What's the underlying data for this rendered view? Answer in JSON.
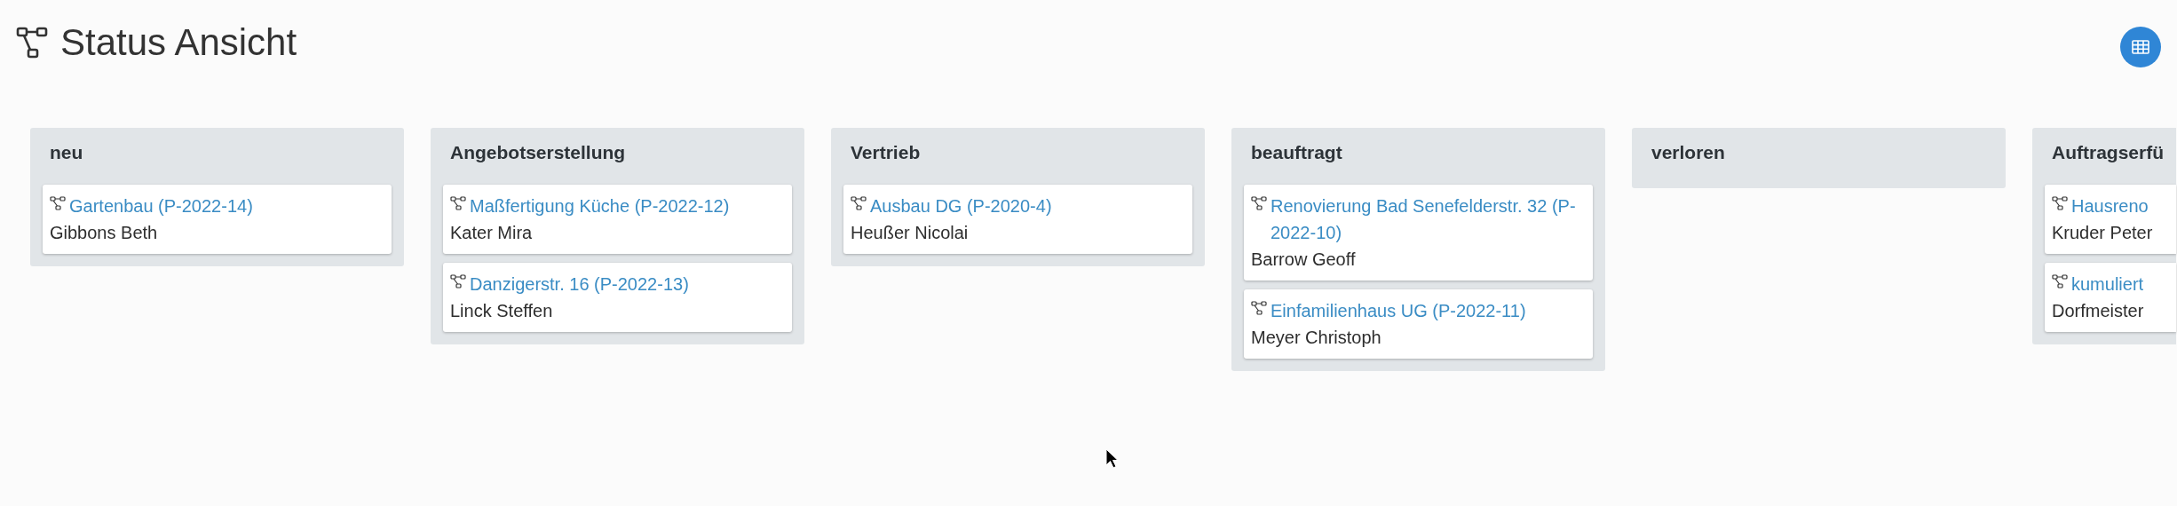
{
  "page": {
    "title": "Status Ansicht"
  },
  "columns": [
    {
      "title": "neu",
      "cards": [
        {
          "project": "Gartenbau (P-2022-14)",
          "customer": "Gibbons Beth"
        }
      ]
    },
    {
      "title": "Angebotserstellung",
      "cards": [
        {
          "project": "Maßfertigung Küche (P-2022-12)",
          "customer": "Kater Mira"
        },
        {
          "project": "Danzigerstr. 16 (P-2022-13)",
          "customer": "Linck Steffen"
        }
      ]
    },
    {
      "title": "Vertrieb",
      "cards": [
        {
          "project": "Ausbau DG (P-2020-4)",
          "customer": "Heußer Nicolai"
        }
      ]
    },
    {
      "title": "beauftragt",
      "cards": [
        {
          "project": "Renovierung Bad Senefelderstr. 32 (P-2022-10)",
          "customer": "Barrow Geoff"
        },
        {
          "project": "Einfamilienhaus UG (P-2022-11)",
          "customer": "Meyer Christoph"
        }
      ]
    },
    {
      "title": "verloren"
    },
    {
      "title": "Auftragserfü",
      "cards": [
        {
          "project": "Hausreno",
          "customer": "Kruder Peter"
        },
        {
          "project": "kumuliert",
          "customer": "Dorfmeister"
        }
      ]
    }
  ]
}
